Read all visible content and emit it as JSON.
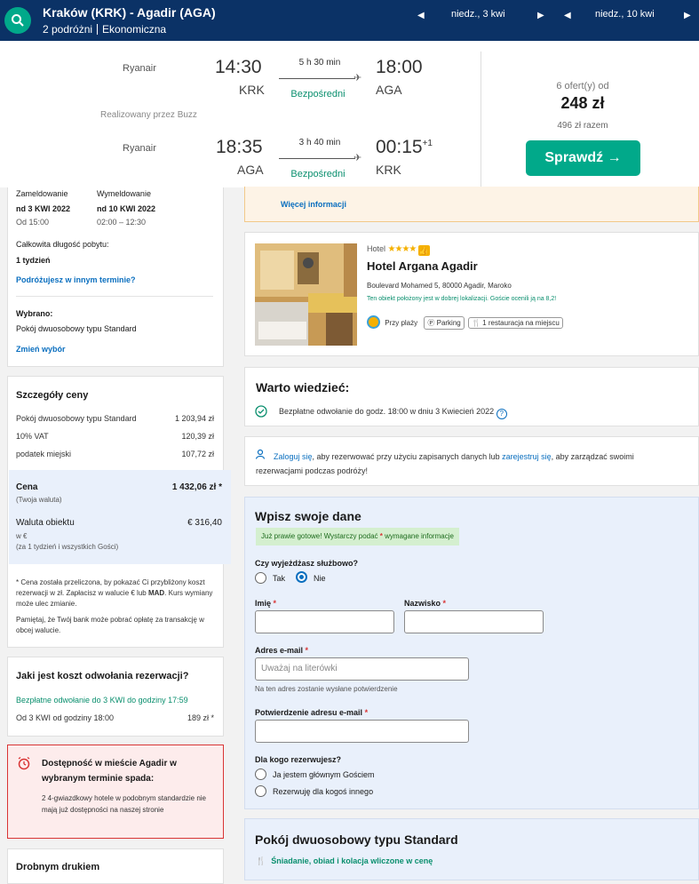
{
  "header": {
    "route": "Kraków (KRK) - Agadir (AGA)",
    "travelers": "2 podróżni",
    "cabin": "Ekonomiczna",
    "depart_date": "niedz., 3 kwi",
    "return_date": "niedz., 10 kwi"
  },
  "flights": {
    "outbound": {
      "airline": "Ryanair",
      "dep_time": "14:30",
      "dep_code": "KRK",
      "duration": "5 h 30 min",
      "stops": "Bezpośredni",
      "arr_time": "18:00",
      "arr_code": "AGA"
    },
    "operated_by": "Realizowany przez Buzz",
    "inbound": {
      "airline": "Ryanair",
      "dep_time": "18:35",
      "dep_code": "AGA",
      "duration": "3 h 40 min",
      "stops": "Bezpośredni",
      "arr_time": "00:15",
      "arr_plus": "+1",
      "arr_code": "KRK"
    },
    "offers": "6 ofert(y) od",
    "price": "248 zł",
    "total": "496 zł razem",
    "check_button": "Sprawdź →"
  },
  "stay": {
    "checkin_label": "Zameldowanie",
    "checkin_date": "nd 3 KWI 2022",
    "checkin_time": "Od 15:00",
    "checkout_label": "Wymeldowanie",
    "checkout_date": "nd 10 KWI 2022",
    "checkout_time": "02:00 – 12:30",
    "length_label": "Całkowita długość pobytu:",
    "length_value": "1 tydzień",
    "other_dates_link": "Podróżujesz w innym terminie?",
    "selected_label": "Wybrano:",
    "selected_value": "Pokój dwuosobowy typu Standard",
    "change_link": "Zmień wybór"
  },
  "price_details": {
    "title": "Szczegóły ceny",
    "rows": [
      {
        "label": "Pokój dwuosobowy typu Standard",
        "value": "1 203,94 zł"
      },
      {
        "label": "10% VAT",
        "value": "120,39 zł"
      },
      {
        "label": "podatek miejski",
        "value": "107,72 zł"
      }
    ],
    "price_label": "Cena",
    "price_sub": "(Twoja waluta)",
    "price_value": "1 432,06 zł *",
    "currency_label": "Waluta obiektu",
    "currency_sub1": "w €",
    "currency_sub2": "(za 1 tydzień i wszystkich Gości)",
    "currency_value": "€ 316,40",
    "note1_a": "* Cena została przeliczona, by pokazać Ci przybliżony koszt rezerwacji w zł. Zapłacisz w walucie € lub ",
    "note1_b": "MAD",
    "note1_c": ". Kurs wymiany może ulec zmianie.",
    "note2": "Pamiętaj, że Twój bank może pobrać opłatę za transakcję w obcej walucie."
  },
  "cancellation": {
    "title": "Jaki jest koszt odwołania rezerwacji?",
    "free": "Bezpłatne odwołanie do 3 KWI do godziny 17:59",
    "from_label": "Od 3 KWI od godziny 18:00",
    "from_value": "189 zł *"
  },
  "availability": {
    "title": "Dostępność w mieście Agadir w wybranym terminie spada:",
    "body": "2 4-gwiazdkowy hotele w podobnym standardzie nie mają już dostępności na naszej stronie"
  },
  "fine_print": {
    "title": "Drobnym drukiem"
  },
  "more_info": "Więcej informacji",
  "hotel": {
    "type": "Hotel",
    "stars": "★★★★",
    "name": "Hotel Argana Agadir",
    "address": "Boulevard Mohamed 5, 80000 Agadir, Maroko",
    "location_note": "Ten obiekt położony jest w dobrej lokalizacji. Goście ocenili ją na 8,2!",
    "tags": [
      "Przy plaży",
      "Parking",
      "1 restauracja na miejscu"
    ]
  },
  "worth_knowing": {
    "title": "Warto wiedzieć:",
    "item": "Bezpłatne odwołanie do godz. 18:00 w dniu 3 Kwiecień 2022"
  },
  "login": {
    "link1": "Zaloguj się",
    "text1": ", aby rezerwować przy użyciu zapisanych danych lub ",
    "link2": "zarejestruj się",
    "text2": ", aby zarządzać swoimi rezerwacjami podczas podróży!"
  },
  "form": {
    "title": "Wpisz swoje dane",
    "banner_a": "Już prawie gotowe! Wystarczy podać ",
    "banner_star": "*",
    "banner_b": " wymagane informacje",
    "business_q": "Czy wyjeżdżasz służbowo?",
    "yes": "Tak",
    "no": "Nie",
    "first_name": "Imię",
    "last_name": "Nazwisko",
    "email_label": "Adres e-mail",
    "email_placeholder": "Uważaj na literówki",
    "email_hint": "Na ten adres zostanie wysłane potwierdzenie",
    "email_confirm_label": "Potwierdzenie adresu e-mail",
    "for_whom_q": "Dla kogo rezerwujesz?",
    "opt_main": "Ja jestem głównym Gościem",
    "opt_other": "Rezerwuję dla kogoś innego",
    "required_mark": "*"
  },
  "room": {
    "title": "Pokój dwuosobowy typu Standard",
    "meals": "Śniadanie, obiad i kolacja wliczone w cenę"
  },
  "colors": {
    "navy": "#0b3266",
    "teal": "#01a98a",
    "link": "#0b6fbf",
    "green": "#0a8f6e",
    "alert": "#d93535"
  }
}
